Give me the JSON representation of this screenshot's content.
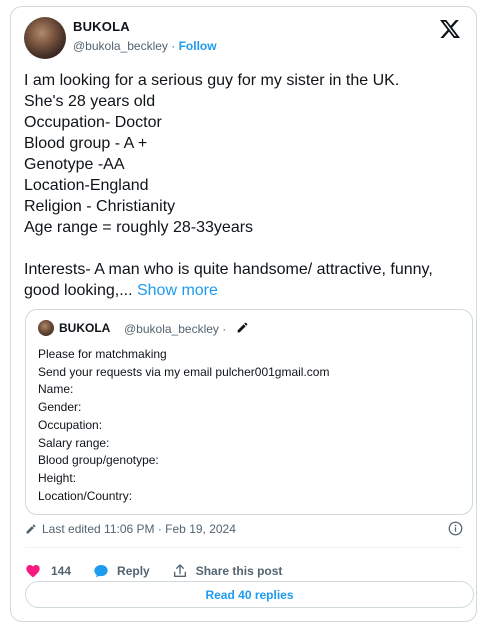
{
  "author": {
    "name": "BUKOLA",
    "handle": "@bukola_beckley",
    "separator": " · ",
    "follow_label": "Follow"
  },
  "tweet": {
    "body": "I am looking for a serious guy for my sister in the UK.\nShe's 28 years old\nOccupation- Doctor\nBlood group - A +\nGenotype -AA\nLocation-England\nReligion - Christianity\nAge range = roughly 28-33years\n\nInterests- A man who is quite handsome/ attractive, funny, good looking,... ",
    "show_more_label": "Show more"
  },
  "quote": {
    "name": "BUKOLA",
    "handle": "@bukola_beckley · ",
    "body": "Please for matchmaking\nSend your requests  via my email pulcher001gmail.com\nName:\nGender:\nOccupation:\nSalary range:\nBlood group/genotype:\nHeight:\nLocation/Country:"
  },
  "meta": {
    "edited_label": "Last edited 11:06 PM · Feb 19, 2024"
  },
  "actions": {
    "like_count": "144",
    "reply_label": "Reply",
    "share_label": "Share this post",
    "read_replies_label": "Read 40 replies"
  },
  "colors": {
    "accent": "#1d9bf0",
    "like": "#f91880",
    "text": "#0f1419",
    "muted": "#536471",
    "border": "#cfd9de"
  },
  "icons": [
    "x-logo-icon",
    "pencil-icon",
    "info-icon",
    "heart-icon",
    "reply-bubble-icon",
    "share-icon"
  ]
}
